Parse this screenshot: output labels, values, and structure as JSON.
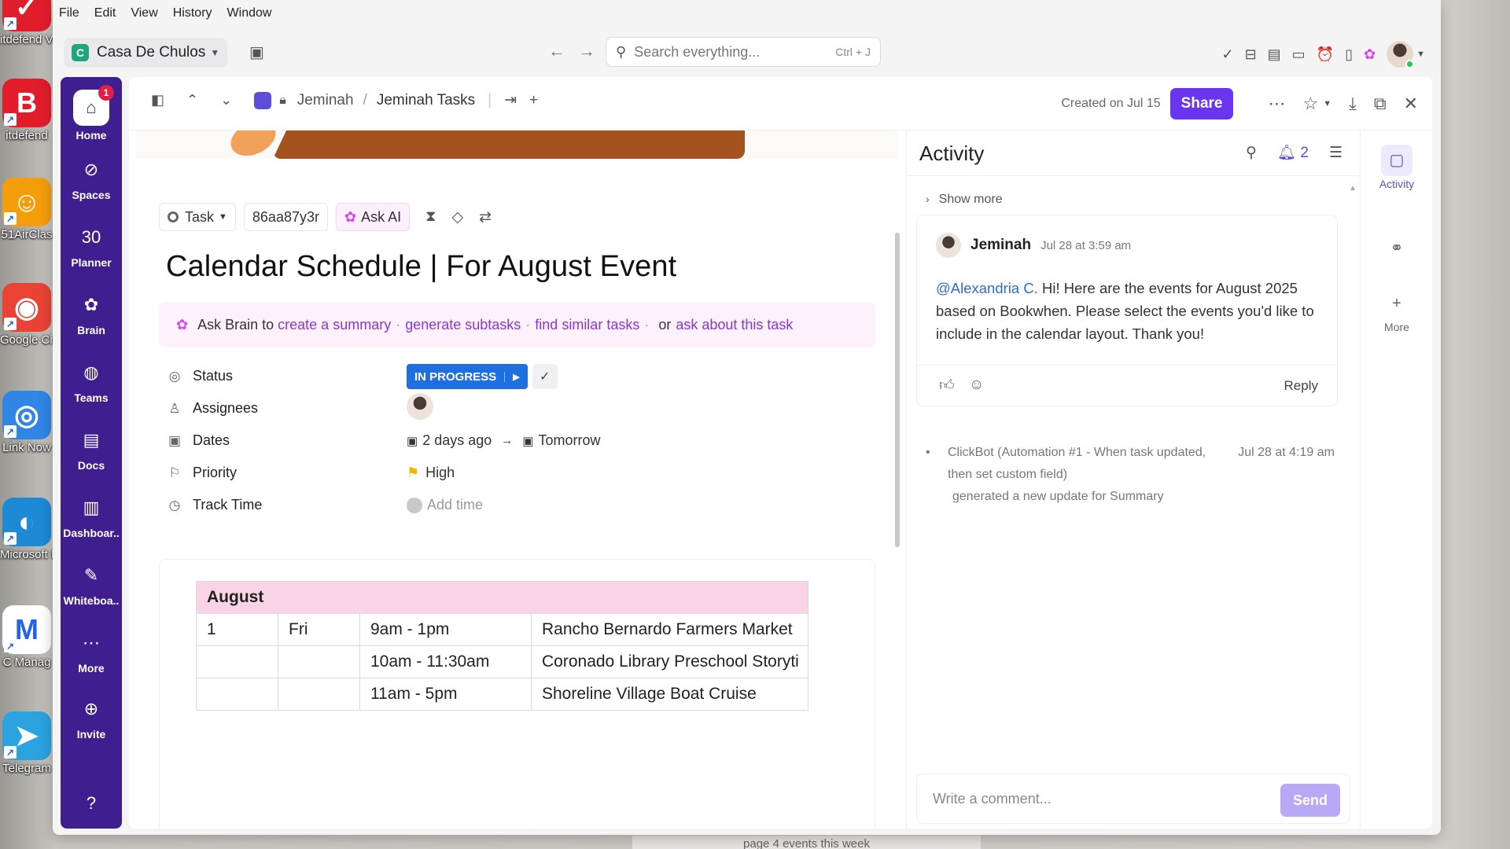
{
  "desktop": {
    "icons": [
      {
        "label": "itdefend VPN",
        "color": "#e11d2c",
        "glyph": "✓"
      },
      {
        "label": "itdefend",
        "color": "#e11d2c",
        "glyph": "B"
      },
      {
        "label": "51AirClas",
        "color": "#f59e0b",
        "glyph": "☺"
      },
      {
        "label": "Google Chrome",
        "color": "#ea4335",
        "glyph": "◉"
      },
      {
        "label": "Link Now",
        "color": "#2f86e6",
        "glyph": "◎"
      },
      {
        "label": "Microsoft Edge",
        "color": "#1e8ad6",
        "glyph": "◐"
      },
      {
        "label": "C Manag",
        "color": "#ffffff",
        "glyph": "M"
      },
      {
        "label": "Telegram",
        "color": "#2aa3e0",
        "glyph": "➤"
      }
    ],
    "bottom_strip_text": "page 4 events this week"
  },
  "menu": [
    "File",
    "Edit",
    "View",
    "History",
    "Window"
  ],
  "workspace": {
    "badge": "C",
    "name": "Casa De Chulos"
  },
  "search": {
    "placeholder": "Search everything...",
    "shortcut": "Ctrl + J"
  },
  "leftnav": [
    {
      "label": "Home",
      "icon": "home-icon",
      "glyph": "⌂",
      "badge": "1",
      "active": true
    },
    {
      "label": "Spaces",
      "icon": "spaces-icon",
      "glyph": "⊘"
    },
    {
      "label": "Planner",
      "icon": "planner-icon",
      "glyph": "30"
    },
    {
      "label": "Brain",
      "icon": "brain-icon",
      "glyph": "✿"
    },
    {
      "label": "Teams",
      "icon": "teams-icon",
      "glyph": "◍"
    },
    {
      "label": "Docs",
      "icon": "docs-icon",
      "glyph": "▤"
    },
    {
      "label": "Dashboar..",
      "icon": "dashboard-icon",
      "glyph": "▥"
    },
    {
      "label": "Whiteboa..",
      "icon": "whiteboard-icon",
      "glyph": "✎"
    },
    {
      "label": "More",
      "icon": "more-icon",
      "glyph": "⋯"
    },
    {
      "label": "Invite",
      "icon": "invite-icon",
      "glyph": "⊕"
    },
    {
      "label": "",
      "icon": "help-icon",
      "glyph": "?"
    }
  ],
  "breadcrumb": {
    "space": "Jeminah",
    "list": "Jeminah Tasks"
  },
  "header": {
    "created": "Created on Jul 15",
    "share": "Share"
  },
  "task": {
    "type": "Task",
    "id": "86aa87y3r",
    "ask_ai": "Ask AI",
    "title": "Calendar Schedule | For August Event",
    "brain": {
      "prefix": "Ask Brain to",
      "link1": "create a summary",
      "link2": "generate subtasks",
      "link3": "find similar tasks",
      "or": "or",
      "link4": "ask about this task"
    },
    "fields": {
      "status_label": "Status",
      "status_value": "IN PROGRESS",
      "assignees_label": "Assignees",
      "dates_label": "Dates",
      "date_start": "2 days ago",
      "date_end": "Tomorrow",
      "priority_label": "Priority",
      "priority_value": "High",
      "track_label": "Track Time",
      "track_value": "Add time"
    },
    "status_color": "#1e6fe0",
    "priority_color": "#f4b400"
  },
  "calendar_table": {
    "month": "August",
    "rows": [
      {
        "day": "1",
        "weekday": "Fri",
        "time": "9am - 1pm",
        "event": "Rancho Bernardo Farmers Market"
      },
      {
        "day": "",
        "weekday": "",
        "time": "10am - 11:30am",
        "event": "Coronado Library Preschool Storyti"
      },
      {
        "day": "",
        "weekday": "",
        "time": "11am - 5pm",
        "event": "Shoreline Village Boat Cruise"
      }
    ]
  },
  "activity": {
    "title": "Activity",
    "bell_count": "2",
    "show_more": "Show more",
    "comment": {
      "author": "Jeminah",
      "time": "Jul 28 at 3:59 am",
      "mention": "@Alexandria C.",
      "body": " Hi! Here are the events for August 2025 based on Bookwhen. Please select the events you'd like to include in the calendar layout. Thank you!",
      "reply": "Reply"
    },
    "log": {
      "text": "ClickBot (Automation #1 - When task updated, then set custom field)",
      "time": "Jul 28 at 4:19 am",
      "sub": "generated a new update for Summary"
    },
    "compose_placeholder": "Write a comment...",
    "send": "Send"
  },
  "rail": [
    {
      "label": "Activity",
      "icon": "chat-bubble-icon",
      "glyph": "▢",
      "active": true
    },
    {
      "label": "",
      "icon": "link-icon",
      "glyph": "⚭"
    },
    {
      "label": "More",
      "icon": "plus-icon",
      "glyph": "+"
    }
  ],
  "colors": {
    "brand": "#3f1f8f",
    "share": "#6b35f0",
    "link": "#8b35d6"
  }
}
